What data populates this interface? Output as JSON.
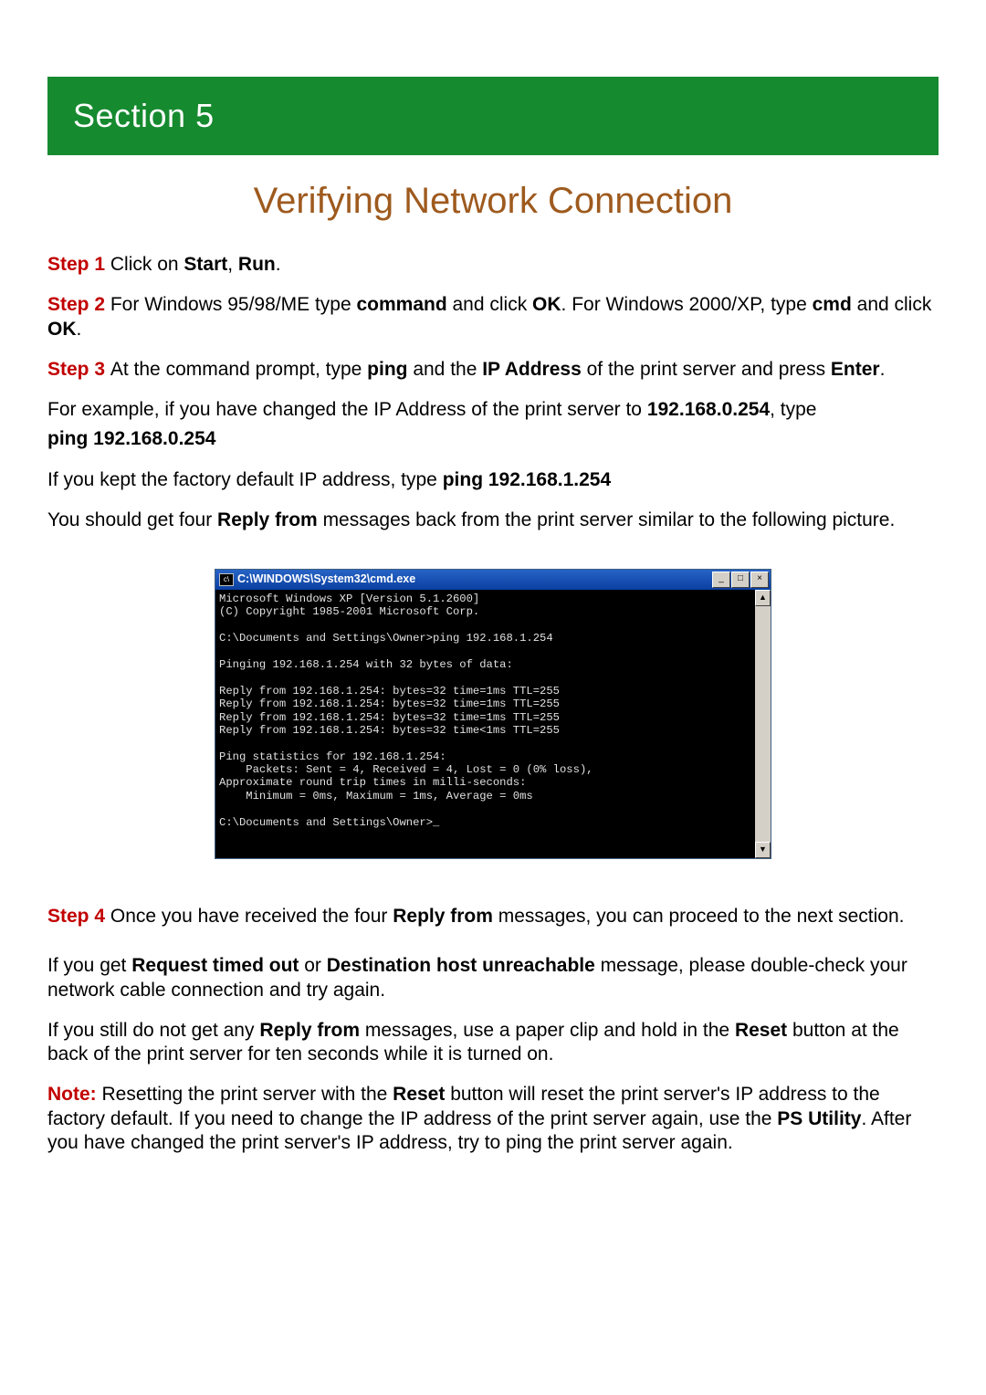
{
  "section_banner": "Section 5",
  "title": "Verifying Network Connection",
  "step1": {
    "label": "Step 1 ",
    "pre": "Click on ",
    "b1": "Start",
    "mid": ", ",
    "b2": "Run",
    "post": "."
  },
  "step2": {
    "label": "Step 2 ",
    "t1": "For Windows 95/98/ME type ",
    "b1": "command",
    "t2": " and click ",
    "b2": "OK",
    "t3": ". For Windows 2000/XP, type ",
    "b3": "cmd",
    "t4": " and click ",
    "b4": "OK",
    "t5": "."
  },
  "step3": {
    "label": "Step 3 ",
    "t1": "At the command prompt, type ",
    "b1": "ping",
    "t2": " and the ",
    "b2": "IP Address",
    "t3": " of the print server and press ",
    "b3": "Enter",
    "t4": "."
  },
  "ex1": {
    "t1": "For example, if you have changed the IP Address of the print server to ",
    "b1": "192.168.0.254",
    "t2": ", type "
  },
  "ex1b": "ping 192.168.0.254",
  "ex2": {
    "t1": "If you kept the factory default IP address, type ",
    "b1": "ping 192.168.1.254"
  },
  "reply_intro": {
    "t1": "You should get four ",
    "b1": "Reply from",
    "t2": " messages back from the print server similar to the following picture."
  },
  "cmd": {
    "title": "C:\\WINDOWS\\System32\\cmd.exe",
    "btn_min": "_",
    "btn_max": "□",
    "btn_close": "×",
    "sb_up": "▲",
    "sb_down": "▼",
    "body": "Microsoft Windows XP [Version 5.1.2600]\n(C) Copyright 1985-2001 Microsoft Corp.\n\nC:\\Documents and Settings\\Owner>ping 192.168.1.254\n\nPinging 192.168.1.254 with 32 bytes of data:\n\nReply from 192.168.1.254: bytes=32 time=1ms TTL=255\nReply from 192.168.1.254: bytes=32 time=1ms TTL=255\nReply from 192.168.1.254: bytes=32 time=1ms TTL=255\nReply from 192.168.1.254: bytes=32 time<1ms TTL=255\n\nPing statistics for 192.168.1.254:\n    Packets: Sent = 4, Received = 4, Lost = 0 (0% loss),\nApproximate round trip times in milli-seconds:\n    Minimum = 0ms, Maximum = 1ms, Average = 0ms\n\nC:\\Documents and Settings\\Owner>_"
  },
  "step4": {
    "label": "Step 4 ",
    "t1": "Once you have received the four ",
    "b1": "Reply from",
    "t2": " messages, you can proceed to the next section."
  },
  "err1": {
    "t1": "If you get ",
    "b1": "Request timed out",
    "t2": " or ",
    "b2": "Destination host unreachable",
    "t3": " message, please double-check your network cable connection and try again."
  },
  "err2": {
    "t1": "If you still do not get any ",
    "b1": "Reply from",
    "t2": " messages, use a paper clip and hold in the ",
    "b2": "Reset",
    "t3": " button at the back of the print server for ten seconds while it is turned on."
  },
  "note": {
    "label": "Note: ",
    "t1": "Resetting the print server with the ",
    "b1": "Reset",
    "t2": " button will reset the print server's IP address to the factory default. If you need to change the IP address of the print server again, use the ",
    "b2": "PS Utility",
    "t3": ". After you have changed the print server's IP address, try to ping the print server again."
  }
}
